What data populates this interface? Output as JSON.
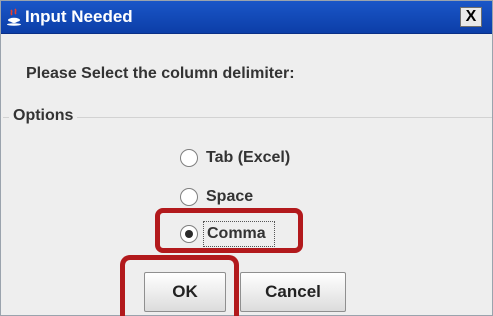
{
  "window": {
    "title": "Input Needed",
    "close_label": "X"
  },
  "prompt": "Please Select the column delimiter:",
  "options_group": {
    "legend": "Options",
    "items": [
      {
        "label": "Tab (Excel)",
        "selected": false
      },
      {
        "label": "Space",
        "selected": false
      },
      {
        "label": "Comma",
        "selected": true
      }
    ]
  },
  "buttons": {
    "ok": "OK",
    "cancel": "Cancel"
  },
  "colors": {
    "title_bar": "#0c3ea8",
    "annotation_highlight": "#b2191c"
  }
}
